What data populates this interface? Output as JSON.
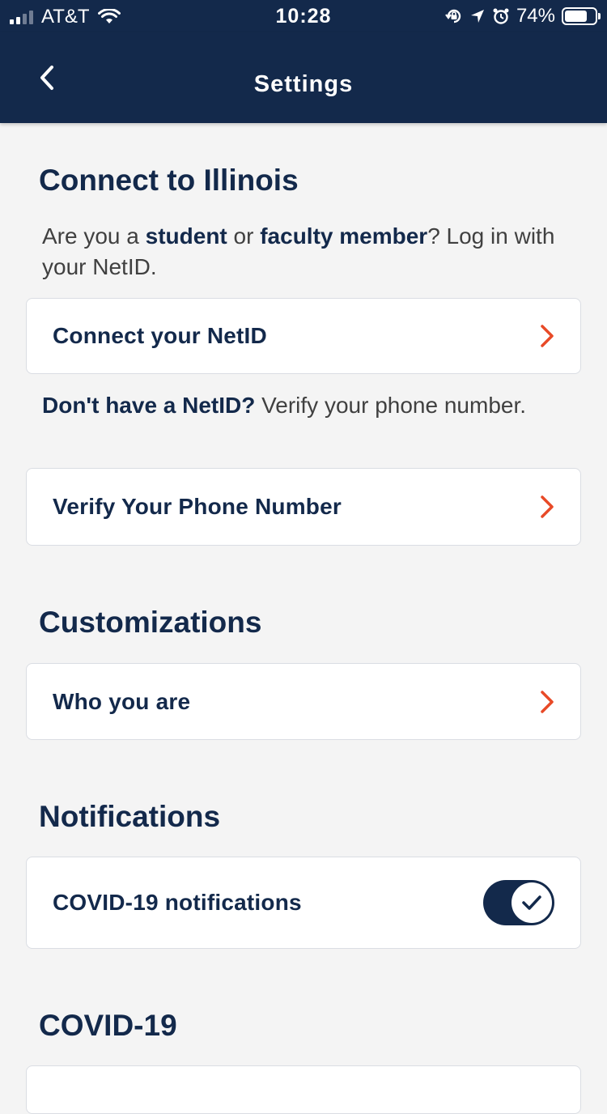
{
  "status_bar": {
    "carrier": "AT&T",
    "time": "10:28",
    "battery": "74%",
    "battery_level": 0.74,
    "icons": [
      "signal-icon",
      "wifi-icon",
      "orientation-lock-icon",
      "location-icon",
      "alarm-icon",
      "battery-icon"
    ]
  },
  "header": {
    "title": "Settings",
    "back_icon": "chevron-left-icon"
  },
  "connect": {
    "title": "Connect to Illinois",
    "desc_1": "Are you a ",
    "desc_student": "student",
    "desc_2": " or ",
    "desc_faculty": "faculty member",
    "desc_3": "? Log in with your NetID.",
    "netid_button": "Connect your NetID",
    "phone_desc_bold": "Don't have a NetID?",
    "phone_desc": " Verify your phone number.",
    "phone_button": "Verify Your Phone Number"
  },
  "customizations": {
    "title": "Customizations",
    "who_button": "Who you are"
  },
  "notifications": {
    "title": "Notifications",
    "covid_label": "COVID-19 notifications",
    "covid_enabled": true
  },
  "covid": {
    "title": "COVID-19"
  },
  "colors": {
    "navy": "#13294b",
    "accent_orange": "#e84a27",
    "background": "#f4f4f4"
  }
}
